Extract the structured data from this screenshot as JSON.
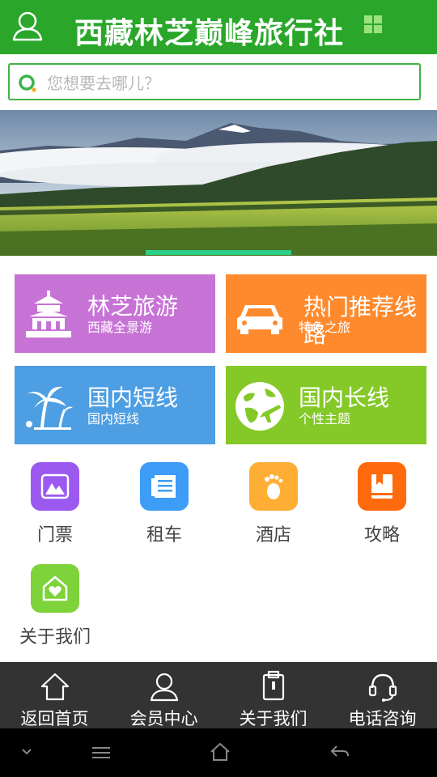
{
  "header": {
    "title": "西藏林芝巅峰旅行社"
  },
  "search": {
    "placeholder": "您想要去哪儿？"
  },
  "tiles": [
    {
      "title": "林芝旅游",
      "subtitle": "西藏全景游",
      "color": "#c773d6",
      "icon": "temple-icon"
    },
    {
      "title": "热门推荐线路",
      "subtitle": "特色之旅",
      "color": "#ff8a2e",
      "icon": "car-icon"
    },
    {
      "title": "国内短线",
      "subtitle": "国内短线",
      "color": "#4d9ee2",
      "icon": "palm-tree-icon"
    },
    {
      "title": "国内长线",
      "subtitle": "个性主题",
      "color": "#84c928",
      "icon": "globe-plane-icon"
    }
  ],
  "quick_links": [
    {
      "label": "门票",
      "color": "#9b59f0",
      "icon": "mountain-ticket-icon"
    },
    {
      "label": "租车",
      "color": "#3d9cf5",
      "icon": "document-icon"
    },
    {
      "label": "酒店",
      "color": "#ffae35",
      "icon": "footprint-icon"
    },
    {
      "label": "攻略",
      "color": "#ff6a0f",
      "icon": "book-icon"
    },
    {
      "label": "关于我们",
      "color": "#7ed23a",
      "icon": "house-heart-icon"
    }
  ],
  "bottom_nav": [
    {
      "label": "返回首页",
      "icon": "home-icon"
    },
    {
      "label": "会员中心",
      "icon": "user-icon"
    },
    {
      "label": "关于我们",
      "icon": "clipboard-icon"
    },
    {
      "label": "电话咨询",
      "icon": "headset-icon"
    }
  ],
  "system_bar": [
    "chevron-down-icon",
    "menu-icon",
    "home-outline-icon",
    "back-icon"
  ],
  "colors": {
    "header": "#2aa72a",
    "nav": "#333333",
    "banner_indicator": "#2bcf8a"
  }
}
